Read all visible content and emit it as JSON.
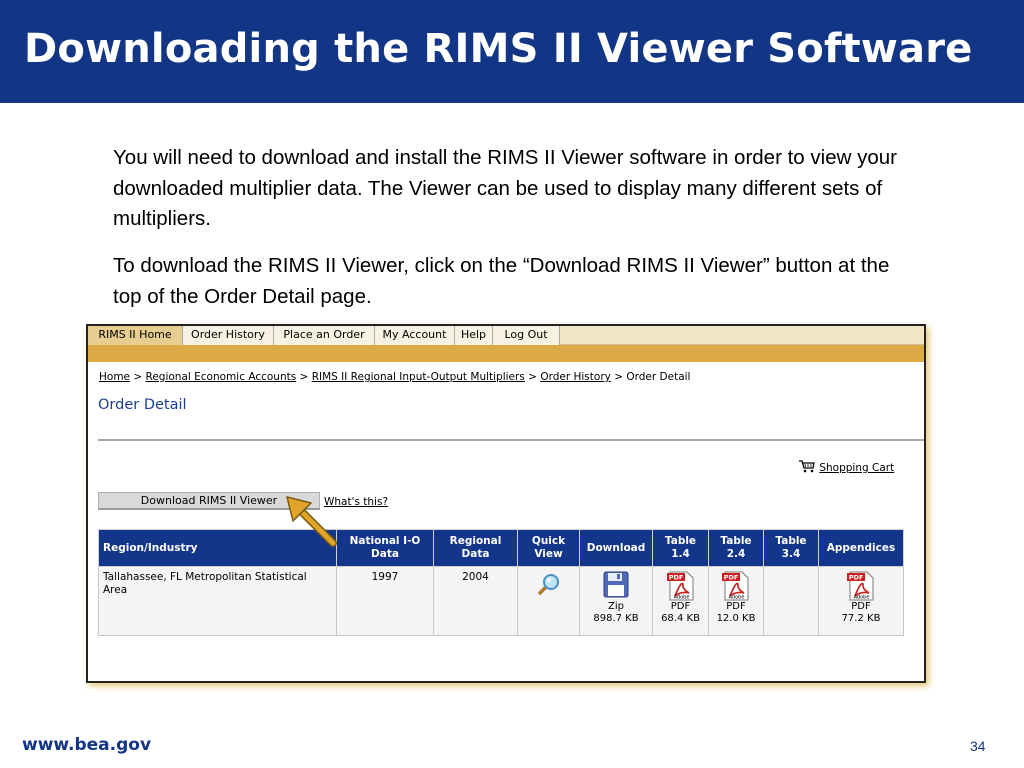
{
  "slide": {
    "title": "Downloading the RIMS II Viewer Software",
    "paragraph1": "You will need to download and install the RIMS II Viewer software in order to view your downloaded multiplier data.  The Viewer can be used to display many different sets of multipliers.",
    "paragraph2": "To download the RIMS II Viewer, click on the “Download RIMS II Viewer” button at the top of the Order Detail page.",
    "footer_url": "www.bea.gov",
    "page_number": "34"
  },
  "screenshot": {
    "tabs": [
      "RIMS II Home",
      "Order History",
      "Place an Order",
      "My Account",
      "Help",
      "Log Out"
    ],
    "breadcrumb": {
      "items": [
        "Home",
        "Regional Economic Accounts",
        "RIMS II Regional Input-Output Multipliers",
        "Order History"
      ],
      "separator": ">",
      "current": "Order Detail"
    },
    "page_title": "Order Detail",
    "shopping_cart": "Shopping Cart",
    "download_button": "Download RIMS II Viewer",
    "whats_this": "What's this?",
    "table": {
      "headers": [
        "Region/Industry",
        "National I-O Data",
        "Regional Data",
        "Quick View",
        "Download",
        "Table 1.4",
        "Table 2.4",
        "Table 3.4",
        "Appendices"
      ],
      "row": {
        "region": "Tallahassee, FL Metropolitan Statistical Area",
        "national_io": "1997",
        "regional": "2004",
        "download_type": "Zip",
        "download_size": "898.7 KB",
        "table14_type": "PDF",
        "table14_size": "68.4 KB",
        "table24_type": "PDF",
        "table24_size": "12.0 KB",
        "appendices_type": "PDF",
        "appendices_size": "77.2 KB"
      },
      "pdf_icon_text": "PDF",
      "adobe_text": "Adobe"
    }
  },
  "colors": {
    "title_bar": "#123585",
    "header_row": "#13358a",
    "gold_band": "#dba945",
    "arrow": "#e0a52a"
  },
  "icons": [
    "magnifier-icon",
    "floppy-disk-icon",
    "pdf-icon",
    "shopping-cart-icon",
    "pointer-arrow-icon"
  ]
}
